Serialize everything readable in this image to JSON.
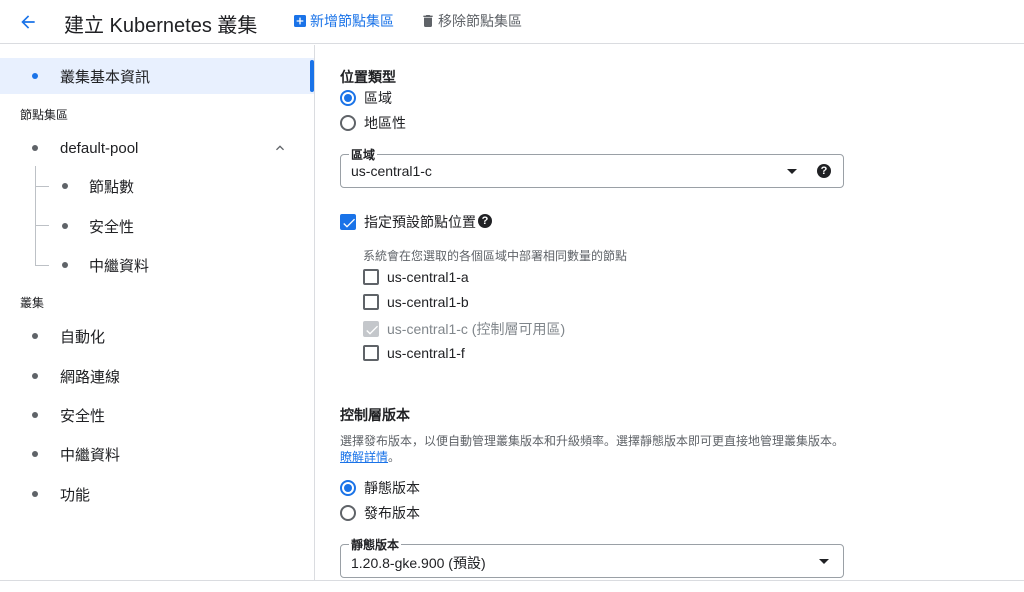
{
  "header": {
    "back_icon": "arrow-back-icon",
    "title": "建立 Kubernetes 叢集",
    "add_node_pool": "新增節點集區",
    "remove_node_pool": "移除節點集區"
  },
  "sidebar": {
    "items": {
      "cluster_basics": "叢集基本資訊",
      "node_pools_section": "節點集區",
      "default_pool": "default-pool",
      "nodes": "節點數",
      "pool_security": "安全性",
      "pool_metadata": "中繼資料",
      "cluster_section": "叢集",
      "automation": "自動化",
      "networking": "網路連線",
      "cluster_security": "安全性",
      "cluster_metadata": "中繼資料",
      "features": "功能"
    }
  },
  "location": {
    "heading": "位置類型",
    "options": [
      "區域",
      "地區性"
    ],
    "selected": "區域",
    "zone_field": {
      "label": "區域",
      "value": "us-central1-c"
    },
    "specify_default_nodes": "指定預設節點位置",
    "note": "系統會在您選取的各個區域中部署相同數量的節點",
    "zones": [
      {
        "label": "us-central1-a",
        "checked": false,
        "disabled": false
      },
      {
        "label": "us-central1-b",
        "checked": false,
        "disabled": false
      },
      {
        "label": "us-central1-c (控制層可用區)",
        "checked": true,
        "disabled": true
      },
      {
        "label": "us-central1-f",
        "checked": false,
        "disabled": false
      }
    ]
  },
  "control_plane": {
    "heading": "控制層版本",
    "description": "選擇發布版本，以便自動管理叢集版本和升級頻率。選擇靜態版本即可更直接地管理叢集版本。",
    "learn_more": "瞭解詳情",
    "period": "。",
    "options": [
      "靜態版本",
      "發布版本"
    ],
    "selected": "靜態版本",
    "version_field": {
      "label": "靜態版本",
      "value": "1.20.8-gke.900 (預設)"
    }
  },
  "colors": {
    "accent": "#1a73e8",
    "active_bg": "#e8f0fe",
    "border": "#dadce0"
  }
}
